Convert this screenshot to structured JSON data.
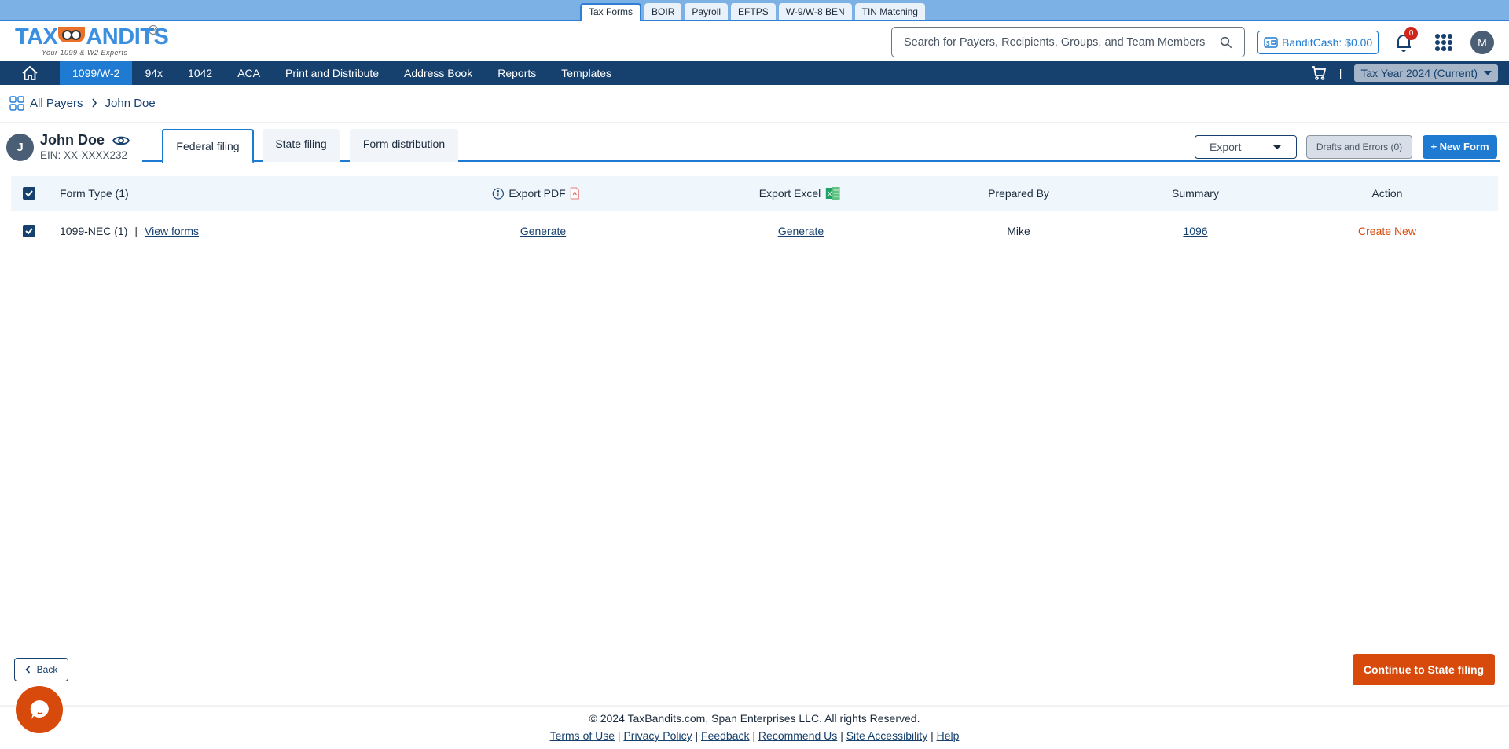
{
  "product_tabs": [
    {
      "label": "Tax Forms",
      "active": true
    },
    {
      "label": "BOIR"
    },
    {
      "label": "Payroll"
    },
    {
      "label": "EFTPS"
    },
    {
      "label": "W-9/W-8 BEN"
    },
    {
      "label": "TIN Matching"
    }
  ],
  "header": {
    "logo_text_left": "TAX",
    "logo_text_right": "ANDITS",
    "logo_tm": "TM",
    "logo_tagline": "Your 1099 & W2 Experts",
    "search_placeholder": "Search for Payers, Recipients, Groups, and Team Members",
    "search_value": "",
    "bandit_cash_label": "BanditCash: $0.00",
    "notification_count": "0",
    "user_initial": "M"
  },
  "main_nav": {
    "items": [
      {
        "label": "1099/W-2",
        "active": true
      },
      {
        "label": "94x"
      },
      {
        "label": "1042"
      },
      {
        "label": "ACA"
      },
      {
        "label": "Print and Distribute"
      },
      {
        "label": "Address Book"
      },
      {
        "label": "Reports"
      },
      {
        "label": "Templates"
      }
    ],
    "separator": "|",
    "tax_year": "Tax Year 2024 (Current)"
  },
  "breadcrumb": {
    "items": [
      "All Payers",
      "John Doe"
    ],
    "separator": ">"
  },
  "payer": {
    "initial": "J",
    "name": "John Doe",
    "ein": "EIN: XX-XXXX232"
  },
  "filing_tabs": [
    {
      "label": "Federal filing",
      "active": true
    },
    {
      "label": "State filing"
    },
    {
      "label": "Form distribution"
    }
  ],
  "actions": {
    "export_select": "Export",
    "drafts_label": "Drafts and Errors (0)",
    "new_form_label": "+ New Form"
  },
  "table": {
    "headers": {
      "form_type": "Form Type  (1)",
      "export_pdf": "Export PDF",
      "export_excel": "Export Excel",
      "prepared_by": "Prepared By",
      "summary": "Summary",
      "action": "Action"
    },
    "rows": [
      {
        "checked": true,
        "form_type": "1099-NEC (1)",
        "pipe": "|",
        "view_forms": "View forms",
        "export_pdf": "Generate",
        "export_excel": "Generate",
        "prepared_by": "Mike",
        "summary": "1096",
        "action": "Create New"
      }
    ]
  },
  "bottom": {
    "back_label": "Back",
    "continue_label": "Continue to State filing"
  },
  "footer": {
    "copyright": "© 2024 TaxBandits.com, Span Enterprises LLC. All rights Reserved.",
    "links": [
      "Terms of Use",
      "Privacy Policy",
      "Feedback",
      "Recommend Us",
      "Site Accessibility",
      "Help"
    ],
    "separator": "|"
  },
  "colors": {
    "navy": "#16406e",
    "primary_blue": "#1f7bd1",
    "accent_orange": "#d84a0c",
    "table_header_bg": "#eff6fc"
  }
}
